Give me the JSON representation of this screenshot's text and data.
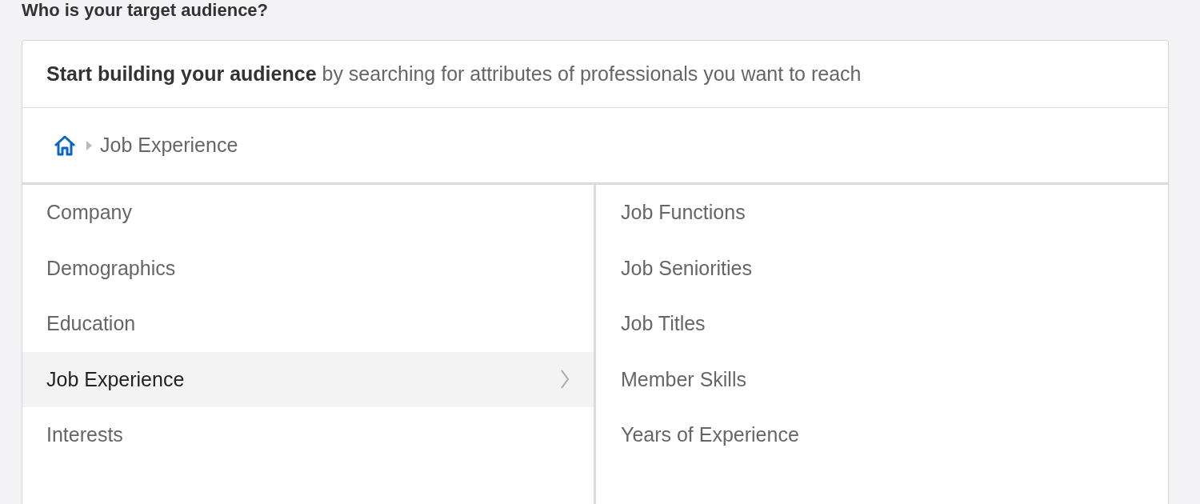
{
  "title": "Who is your target audience?",
  "card": {
    "intro": "**Start building your audience** by searching for attributes of professionals you want to reach",
    "breadcrumb": [
      "Job Experience"
    ],
    "categories": [
      {
        "label": "Company",
        "selected": false
      },
      {
        "label": "Demographics",
        "selected": false
      },
      {
        "label": "Education",
        "selected": false
      },
      {
        "label": "Job Experience",
        "selected": true
      },
      {
        "label": "Interests",
        "selected": false
      }
    ],
    "subcategories": [
      "Job Functions",
      "Job Seniorities",
      "Job Titles",
      "Member Skills",
      "Years of Experience"
    ]
  }
}
